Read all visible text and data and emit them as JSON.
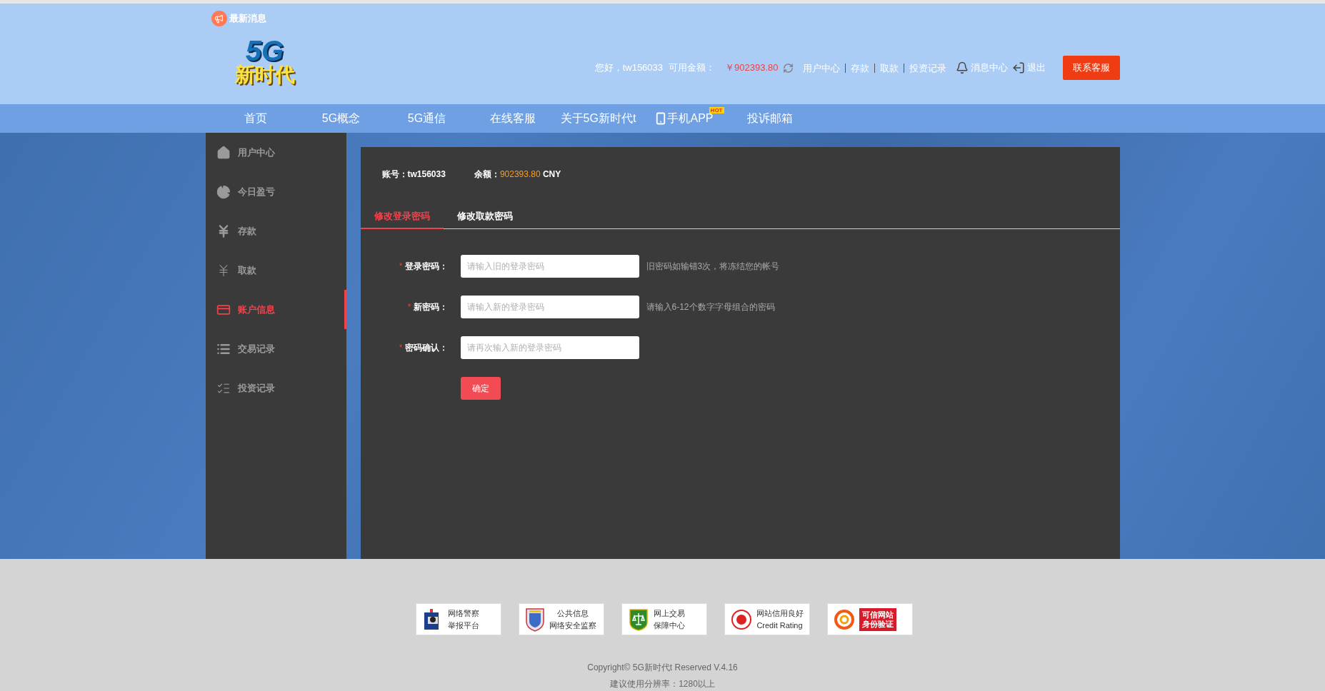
{
  "news": {
    "label": "最新消息"
  },
  "logo": {
    "line_1": "5G",
    "line_2": "新时代"
  },
  "user_bar": {
    "greeting": "您好，tw156033",
    "balance_label": "可用金额：",
    "balance": "￥902393.80",
    "links": [
      {
        "label": "用户中心"
      },
      {
        "label": "存款"
      },
      {
        "label": "取款"
      },
      {
        "label": "投资记录"
      }
    ],
    "messages": "消息中心",
    "logout": "退出",
    "contact_button": "联系客服"
  },
  "nav": [
    {
      "label": "首页"
    },
    {
      "label": "5G概念"
    },
    {
      "label": "5G通信"
    },
    {
      "label": "在线客服"
    },
    {
      "label": "关于5G新时代t"
    },
    {
      "label": "手机APP",
      "badge": "HOT",
      "kind": "app"
    },
    {
      "label": "投诉邮箱"
    }
  ],
  "sidebar": [
    {
      "label": "用户中心",
      "kind": "home",
      "selected": false
    },
    {
      "label": "今日盈亏",
      "kind": "pie",
      "selected": false
    },
    {
      "label": "存款",
      "kind": "yen",
      "selected": false
    },
    {
      "label": "取款",
      "kind": "yen-outline",
      "selected": false
    },
    {
      "label": "账户信息",
      "kind": "card",
      "selected": true
    },
    {
      "label": "交易记录",
      "kind": "list",
      "selected": false
    },
    {
      "label": "投资记录",
      "kind": "list-outline",
      "selected": false
    }
  ],
  "account": {
    "account_label": "账号：",
    "account": "tw156033",
    "balance_label": "余额：",
    "balance": "902393.80",
    "currency": "CNY"
  },
  "tabs": [
    {
      "label": "修改登录密码",
      "selected": true
    },
    {
      "label": "修改取款密码",
      "selected": false
    }
  ],
  "form": {
    "fields": [
      {
        "mark": "*",
        "label": "登录密码：",
        "placeholder": "请输入旧的登录密码",
        "hint": "旧密码如输错3次，将冻结您的帐号"
      },
      {
        "mark": "*",
        "label": "新密码：",
        "placeholder": "请输入新的登录密码",
        "hint": "请输入6-12个数字字母组合的密码"
      },
      {
        "mark": "*",
        "label": "密码确认：",
        "placeholder": "请再次输入新的登录密码"
      }
    ],
    "submit": "确定"
  },
  "footer": {
    "badges": [
      {
        "kind": "police",
        "line_1": "网络警察",
        "line_2": "举报平台"
      },
      {
        "kind": "shield",
        "line_1": "公共信息",
        "line_2": "网络安全监察"
      },
      {
        "kind": "scales",
        "line_1": "网上交易",
        "line_2": "保障中心"
      },
      {
        "kind": "seal",
        "line_1": "网站信用良好",
        "line_2": "Credit Rating"
      },
      {
        "kind": "trusted",
        "line_1": "可信网站",
        "line_2": "身份验证"
      }
    ],
    "copyright": "Copyright© 5G新时代t Reserved V.4.16",
    "resolution": "建议使用分辨率：1280以上"
  }
}
